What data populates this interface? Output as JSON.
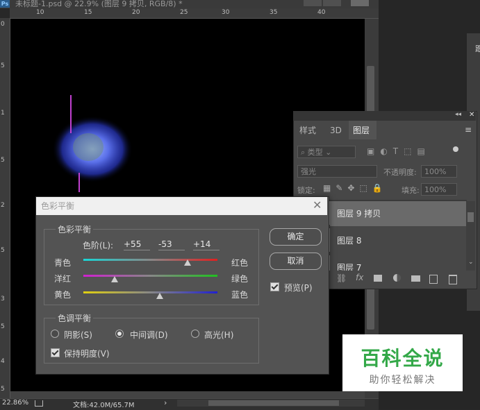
{
  "document": {
    "title": "未标题-1.psd @ 22.9% (图层 9 拷贝, RGB/8) *",
    "ruler_top_labels": [
      "10",
      "15",
      "20",
      "25",
      "30",
      "35",
      "40"
    ],
    "ruler_left_labels": [
      "0",
      "5",
      "1",
      "5",
      "2",
      "5",
      "3",
      "5",
      "4",
      "5"
    ]
  },
  "status": {
    "zoom": "22.86%",
    "doc_size": "文档:42.0M/65.7M"
  },
  "layers_panel": {
    "tabs": [
      "样式",
      "3D",
      "图层"
    ],
    "active_tab": "图层",
    "filter_kind": "类型",
    "blend_mode": "强光",
    "opacity_label": "不透明度:",
    "opacity_value": "100%",
    "lock_label": "锁定:",
    "fill_label": "填充:",
    "fill_value": "100%",
    "layers": [
      "图层 9 拷贝",
      "图层 8",
      "图层 7"
    ],
    "footer_fx": "fx"
  },
  "color_balance_dialog": {
    "title": "色彩平衡",
    "group_color_balance": "色彩平衡",
    "levels_label": "色阶(L):",
    "levels": [
      "+55",
      "-53",
      "+14"
    ],
    "sliders": [
      {
        "left": "青色",
        "right": "红色",
        "value": 55,
        "start_color": "#19d6d6",
        "end_color": "#e02020"
      },
      {
        "left": "洋红",
        "right": "绿色",
        "value": -53,
        "start_color": "#d020d0",
        "end_color": "#20c020"
      },
      {
        "left": "黄色",
        "right": "蓝色",
        "value": 14,
        "start_color": "#e0d010",
        "end_color": "#2020d0"
      }
    ],
    "group_tone_balance": "色调平衡",
    "tones": [
      {
        "label": "阴影(S)",
        "selected": false
      },
      {
        "label": "中间调(D)",
        "selected": true
      },
      {
        "label": "高光(H)",
        "selected": false
      }
    ],
    "preserve_luminosity": "保持明度(V)",
    "preserve_checked": true,
    "ok_button": "确定",
    "cancel_button": "取消",
    "preview_label": "预览(P)",
    "preview_checked": true
  },
  "watermark": {
    "main": "百科全说",
    "sub": "助你轻松解决"
  },
  "colors": {
    "canvas": "#000000",
    "panel": "#474747",
    "dialog": "#535353",
    "watermark_green": "#33a848"
  }
}
